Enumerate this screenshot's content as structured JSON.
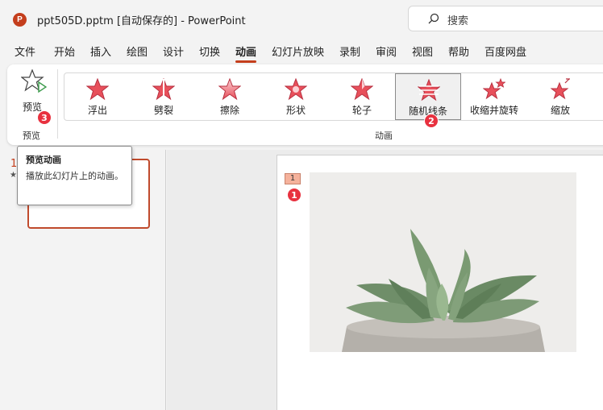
{
  "titlebar": {
    "logo_letter": "P",
    "document_title": "ppt505D.pptm [自动保存的]  -  PowerPoint",
    "search_placeholder": "搜索"
  },
  "menu": {
    "tabs": [
      "文件",
      "开始",
      "插入",
      "绘图",
      "设计",
      "切换",
      "动画",
      "幻灯片放映",
      "录制",
      "审阅",
      "视图",
      "帮助",
      "百度网盘"
    ],
    "active_tab": "动画"
  },
  "ribbon": {
    "preview": {
      "label": "预览",
      "dropdown_glyph": "⌄",
      "group_label": "预览"
    },
    "animation_group_label": "动画",
    "animations": [
      {
        "label": "浮出",
        "selected": false
      },
      {
        "label": "劈裂",
        "selected": false
      },
      {
        "label": "擦除",
        "selected": false
      },
      {
        "label": "形状",
        "selected": false
      },
      {
        "label": "轮子",
        "selected": false
      },
      {
        "label": "随机线条",
        "selected": true
      },
      {
        "label": "收缩并旋转",
        "selected": false
      },
      {
        "label": "缩放",
        "selected": false
      }
    ]
  },
  "badges": {
    "slide_marker_badge": "1",
    "gallery_badge": "2",
    "preview_badge": "3"
  },
  "tooltip": {
    "title": "预览动画",
    "description": "播放此幻灯片上的动画。"
  },
  "thumbnails": {
    "slide_number": "1",
    "star": "★"
  },
  "slide": {
    "animation_marker": "1"
  },
  "colors": {
    "accent": "#c43e1c",
    "badge": "#e8313f",
    "star_fill": "#e8505b"
  }
}
